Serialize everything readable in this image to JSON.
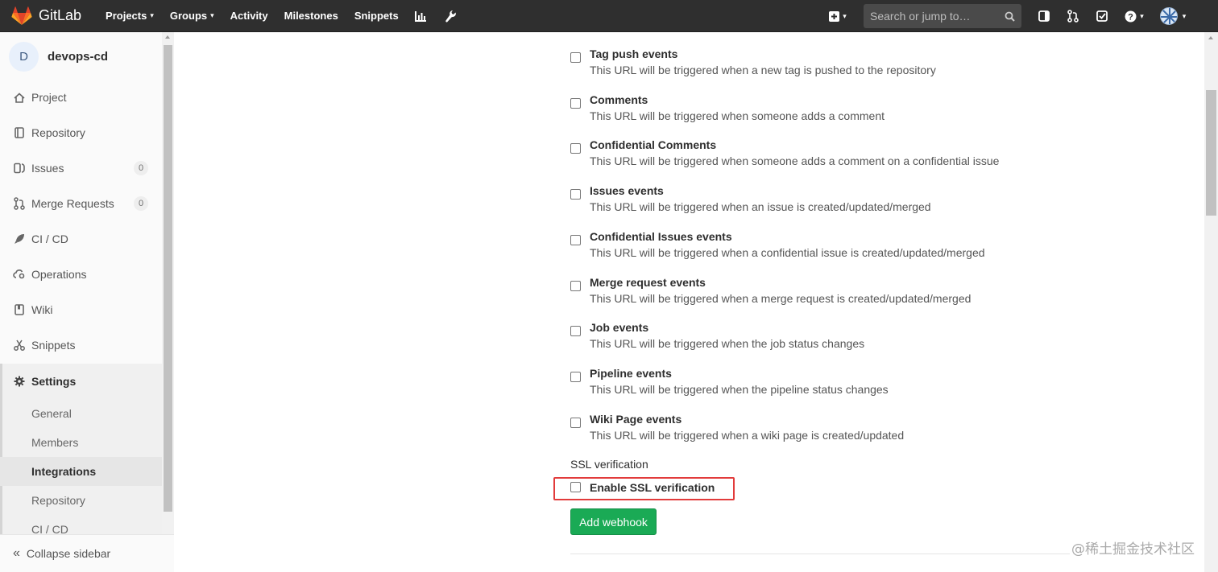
{
  "navbar": {
    "brand": "GitLab",
    "links": [
      "Projects",
      "Groups",
      "Activity",
      "Milestones",
      "Snippets"
    ],
    "search_placeholder": "Search or jump to…"
  },
  "sidebar": {
    "project_initial": "D",
    "project_name": "devops-cd",
    "items": [
      {
        "label": "Project",
        "icon": "home-icon"
      },
      {
        "label": "Repository",
        "icon": "doc-icon"
      },
      {
        "label": "Issues",
        "icon": "issues-icon",
        "badge": "0"
      },
      {
        "label": "Merge Requests",
        "icon": "merge-request-icon",
        "badge": "0"
      },
      {
        "label": "CI / CD",
        "icon": "rocket-icon"
      },
      {
        "label": "Operations",
        "icon": "cloud-gear-icon"
      },
      {
        "label": "Wiki",
        "icon": "book-icon"
      },
      {
        "label": "Snippets",
        "icon": "scissors-icon"
      },
      {
        "label": "Settings",
        "icon": "gear-icon"
      }
    ],
    "settings_sub": [
      "General",
      "Members",
      "Integrations",
      "Repository",
      "CI / CD"
    ],
    "collapse_label": "Collapse sidebar"
  },
  "events": [
    {
      "title": "Tag push events",
      "desc": "This URL will be triggered when a new tag is pushed to the repository",
      "checked": false
    },
    {
      "title": "Comments",
      "desc": "This URL will be triggered when someone adds a comment",
      "checked": false
    },
    {
      "title": "Confidential Comments",
      "desc": "This URL will be triggered when someone adds a comment on a confidential issue",
      "checked": false
    },
    {
      "title": "Issues events",
      "desc": "This URL will be triggered when an issue is created/updated/merged",
      "checked": false
    },
    {
      "title": "Confidential Issues events",
      "desc": "This URL will be triggered when a confidential issue is created/updated/merged",
      "checked": false
    },
    {
      "title": "Merge request events",
      "desc": "This URL will be triggered when a merge request is created/updated/merged",
      "checked": false
    },
    {
      "title": "Job events",
      "desc": "This URL will be triggered when the job status changes",
      "checked": false
    },
    {
      "title": "Pipeline events",
      "desc": "This URL will be triggered when the pipeline status changes",
      "checked": false
    },
    {
      "title": "Wiki Page events",
      "desc": "This URL will be triggered when a wiki page is created/updated",
      "checked": false
    }
  ],
  "ssl": {
    "section_label": "SSL verification",
    "checkbox_label": "Enable SSL verification",
    "checked": false
  },
  "add_webhook_label": "Add webhook",
  "watermark": "@稀土掘金技术社区",
  "colors": {
    "navbar": "#2f2f2f",
    "add_button": "#1aaa55",
    "highlight": "#e23b3b"
  }
}
